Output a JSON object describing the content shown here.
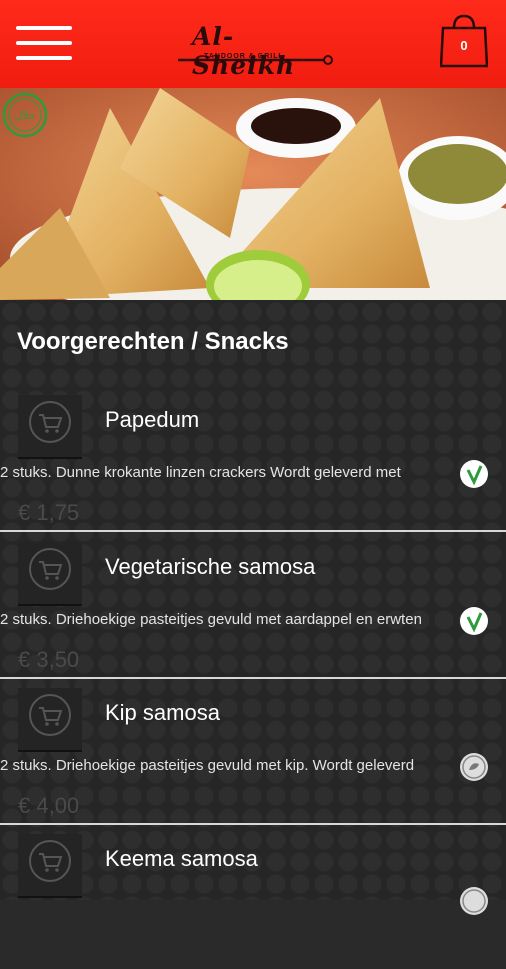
{
  "header": {
    "logo_text": "Al-Sheikh",
    "logo_sub": "TANDOOR & GRILL",
    "cart_count": "0"
  },
  "hero": {
    "halal_label": "حلال"
  },
  "menu": {
    "section_title": "Voorgerechten / Snacks",
    "items": [
      {
        "name": "Papedum",
        "desc": "2 stuks. Dunne krokante linzen crackers Wordt geleverd met",
        "price": "€ 1,75",
        "badge": "vegetarian"
      },
      {
        "name": "Vegetarische samosa",
        "desc": "2 stuks. Driehoekige pasteitjes gevuld met aardappel en erwten",
        "price": "€ 3,50",
        "badge": "vegetarian"
      },
      {
        "name": "Kip samosa",
        "desc": "2 stuks. Driehoekige pasteitjes gevuld met kip. Wordt geleverd",
        "price": "€ 4,00",
        "badge": "meat"
      },
      {
        "name": "Keema samosa",
        "desc": "",
        "price": "",
        "badge": "meat"
      }
    ]
  },
  "colors": {
    "header_red": "#ff2a1a",
    "veg_green": "#2e9b3b"
  }
}
